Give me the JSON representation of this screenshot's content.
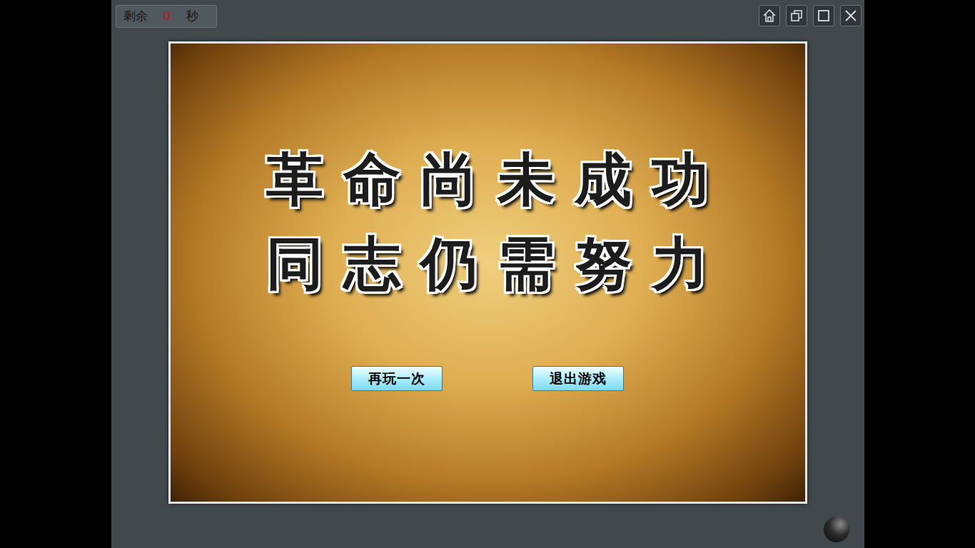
{
  "timer": {
    "prefix": "剩余",
    "value": "0",
    "suffix": "秒"
  },
  "message": {
    "lines": [
      "革命尚未成功",
      "同志仍需努力"
    ]
  },
  "buttons": [
    "再玩一次",
    "退出游戏"
  ]
}
